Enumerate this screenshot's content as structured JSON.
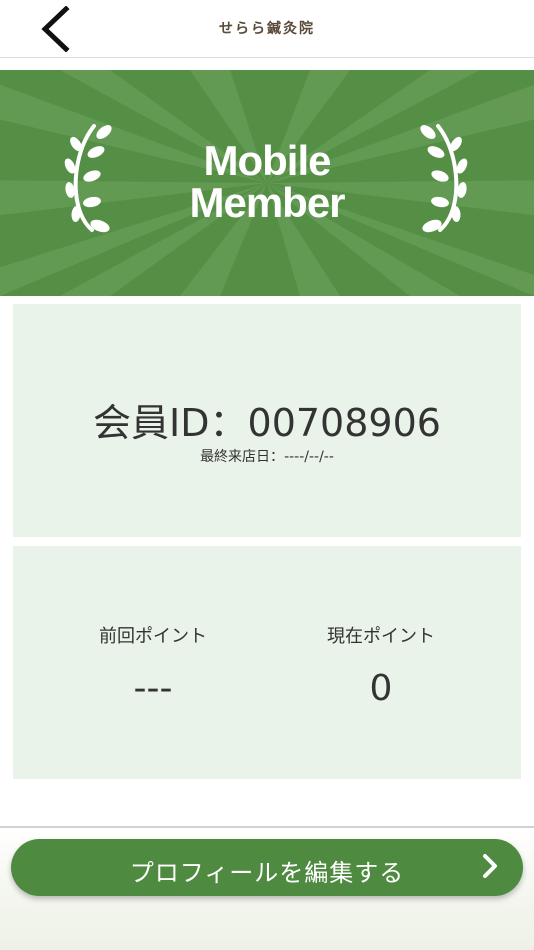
{
  "header": {
    "title": "せらら鍼灸院",
    "back_icon": "chevron-left-icon"
  },
  "hero": {
    "title_line1": "Mobile",
    "title_line2": "Member",
    "background_color": "#558f45",
    "decoration_icon": "laurel-icon"
  },
  "member_card": {
    "member_id_label": "会員ID",
    "member_id_separator": "：",
    "member_id_value": "00708906",
    "last_visit_label": "最終来店日：",
    "last_visit_value": "----/--/--"
  },
  "points": {
    "previous_label": "前回ポイント",
    "previous_value": "---",
    "current_label": "現在ポイント",
    "current_value": "0"
  },
  "actions": {
    "edit_profile_label": "プロフィールを編集する",
    "edit_profile_icon": "chevron-right-icon",
    "accent_color": "#4e8a40"
  }
}
